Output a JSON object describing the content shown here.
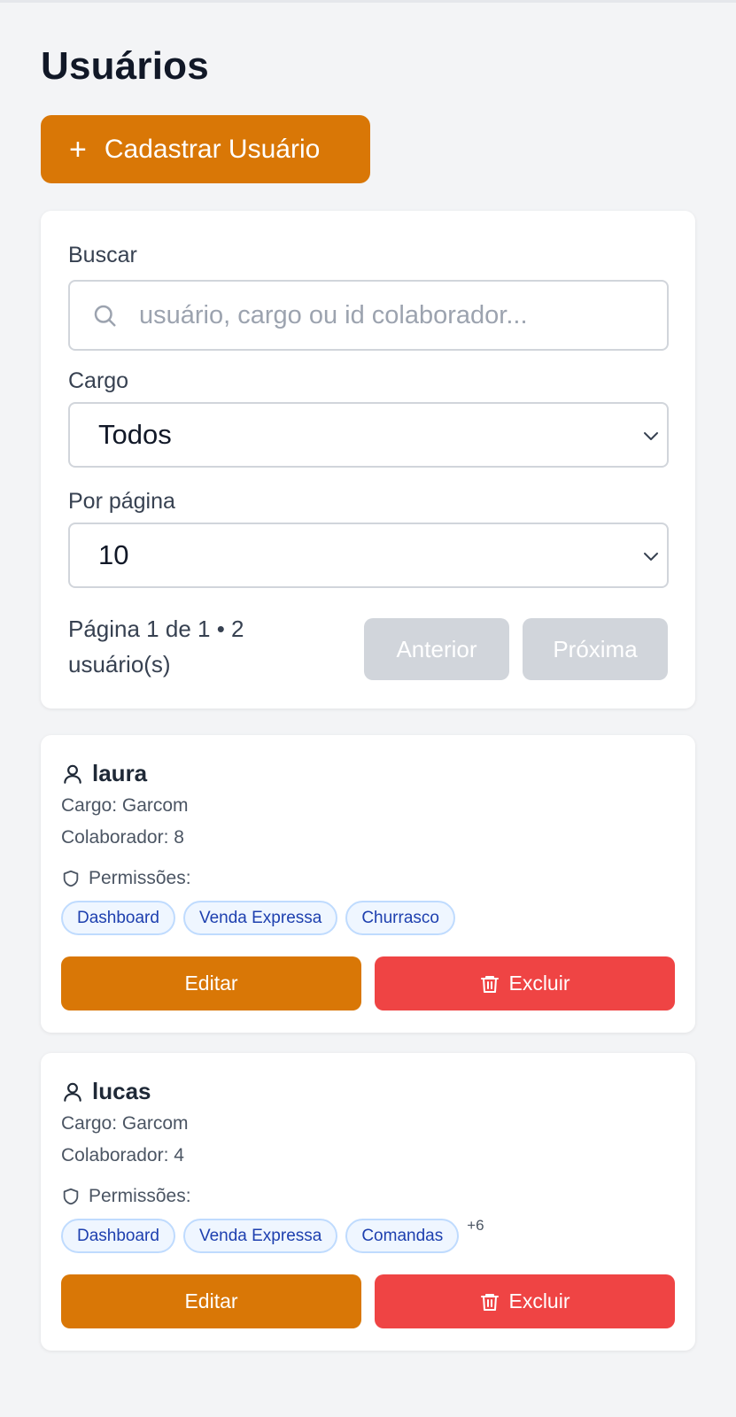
{
  "page": {
    "title": "Usuários"
  },
  "actions": {
    "add_user_label": "Cadastrar Usuário",
    "add_icon": "plus-icon"
  },
  "filters": {
    "search_label": "Buscar",
    "search_placeholder": "usuário, cargo ou id colaborador...",
    "search_value": "",
    "role_label": "Cargo",
    "role_value": "Todos",
    "per_page_label": "Por página",
    "per_page_value": "10",
    "pagination_text": "Página 1 de 1 • 2 usuário(s)",
    "prev_label": "Anterior",
    "next_label": "Próxima"
  },
  "users": [
    {
      "name": "laura",
      "role": "Cargo: Garcom",
      "collaborator": "Colaborador: 8",
      "permissions_label": "Permissões:",
      "permissions": [
        "Dashboard",
        "Venda Expressa",
        "Churrasco"
      ],
      "more": "",
      "edit_label": "Editar",
      "delete_label": "Excluir"
    },
    {
      "name": "lucas",
      "role": "Cargo: Garcom",
      "collaborator": "Colaborador: 4",
      "permissions_label": "Permissões:",
      "permissions": [
        "Dashboard",
        "Venda Expressa",
        "Comandas"
      ],
      "more": "+6",
      "edit_label": "Editar",
      "delete_label": "Excluir"
    }
  ],
  "colors": {
    "accent": "#d97706",
    "danger": "#ef4444",
    "background": "#f3f4f6",
    "tag_bg": "#eff6ff",
    "tag_text": "#1e40af",
    "disabled": "#d1d5db"
  }
}
